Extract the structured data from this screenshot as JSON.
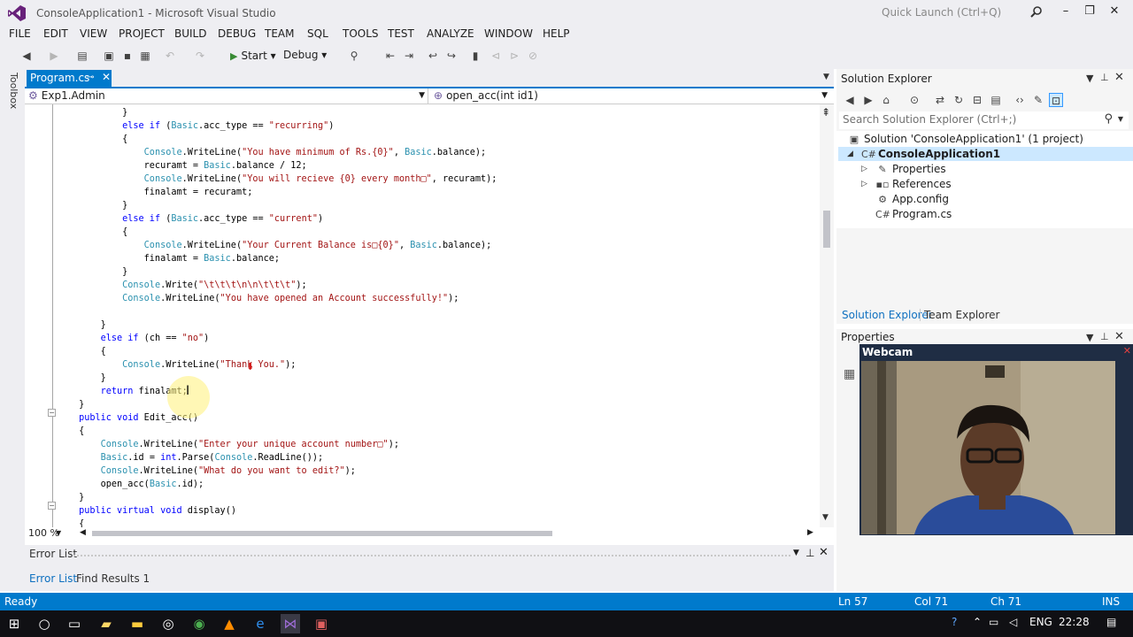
{
  "window": {
    "title": "ConsoleApplication1 - Microsoft Visual Studio",
    "quick_launch": "Quick Launch (Ctrl+Q)"
  },
  "menu": [
    "FILE",
    "EDIT",
    "VIEW",
    "PROJECT",
    "BUILD",
    "DEBUG",
    "TEAM",
    "SQL",
    "TOOLS",
    "TEST",
    "ANALYZE",
    "WINDOW",
    "HELP"
  ],
  "toolbar": {
    "start_label": "Start",
    "config": "Debug"
  },
  "toolbox_label": "Toolbox",
  "editor": {
    "tab_label": "Program.cs",
    "nav_left": "Exp1.Admin",
    "nav_right": "open_acc(int id1)",
    "zoom": "100 %",
    "code_lines": [
      [
        [
          "p",
          "                }"
        ]
      ],
      [
        [
          "p",
          "                "
        ],
        [
          "k",
          "else if"
        ],
        [
          "p",
          " ("
        ],
        [
          "c",
          "Basic"
        ],
        [
          "p",
          ".acc_type == "
        ],
        [
          "s",
          "\"recurring\""
        ],
        [
          "p",
          ")"
        ]
      ],
      [
        [
          "p",
          "                {"
        ]
      ],
      [
        [
          "p",
          "                    "
        ],
        [
          "c",
          "Console"
        ],
        [
          "p",
          ".WriteLine("
        ],
        [
          "s",
          "\"You have minimum of Rs.{0}\""
        ],
        [
          "p",
          ", "
        ],
        [
          "c",
          "Basic"
        ],
        [
          "p",
          ".balance);"
        ]
      ],
      [
        [
          "p",
          "                    recuramt = "
        ],
        [
          "c",
          "Basic"
        ],
        [
          "p",
          ".balance / 12;"
        ]
      ],
      [
        [
          "p",
          "                    "
        ],
        [
          "c",
          "Console"
        ],
        [
          "p",
          ".WriteLine("
        ],
        [
          "s",
          "\"You will recieve {0} every month□\""
        ],
        [
          "p",
          ", recuramt);"
        ]
      ],
      [
        [
          "p",
          "                    finalamt = recuramt;"
        ]
      ],
      [
        [
          "p",
          "                }"
        ]
      ],
      [
        [
          "p",
          "                "
        ],
        [
          "k",
          "else if"
        ],
        [
          "p",
          " ("
        ],
        [
          "c",
          "Basic"
        ],
        [
          "p",
          ".acc_type == "
        ],
        [
          "s",
          "\"current\""
        ],
        [
          "p",
          ")"
        ]
      ],
      [
        [
          "p",
          "                {"
        ]
      ],
      [
        [
          "p",
          "                    "
        ],
        [
          "c",
          "Console"
        ],
        [
          "p",
          ".WriteLine("
        ],
        [
          "s",
          "\"Your Current Balance is□{0}\""
        ],
        [
          "p",
          ", "
        ],
        [
          "c",
          "Basic"
        ],
        [
          "p",
          ".balance);"
        ]
      ],
      [
        [
          "p",
          "                    finalamt = "
        ],
        [
          "c",
          "Basic"
        ],
        [
          "p",
          ".balance;"
        ]
      ],
      [
        [
          "p",
          "                }"
        ]
      ],
      [
        [
          "p",
          "                "
        ],
        [
          "c",
          "Console"
        ],
        [
          "p",
          ".Write("
        ],
        [
          "s",
          "\"\\t\\t\\t\\n\\n\\t\\t\\t\""
        ],
        [
          "p",
          ");"
        ]
      ],
      [
        [
          "p",
          "                "
        ],
        [
          "c",
          "Console"
        ],
        [
          "p",
          ".WriteLine("
        ],
        [
          "s",
          "\"You have opened an Account successfully!\""
        ],
        [
          "p",
          ");"
        ]
      ],
      [
        [
          "p",
          ""
        ]
      ],
      [
        [
          "p",
          "            }"
        ]
      ],
      [
        [
          "p",
          "            "
        ],
        [
          "k",
          "else if"
        ],
        [
          "p",
          " (ch == "
        ],
        [
          "s",
          "\"no\""
        ],
        [
          "p",
          ")"
        ]
      ],
      [
        [
          "p",
          "            {"
        ]
      ],
      [
        [
          "p",
          "                "
        ],
        [
          "c",
          "Console"
        ],
        [
          "p",
          ".WriteLine("
        ],
        [
          "s",
          "\"Thank You.\""
        ],
        [
          "p",
          ");"
        ]
      ],
      [
        [
          "p",
          "            }"
        ]
      ],
      [
        [
          "p",
          "            "
        ],
        [
          "k",
          "return"
        ],
        [
          "p",
          " finalamt;"
        ]
      ],
      [
        [
          "p",
          "        }"
        ]
      ],
      [
        [
          "p",
          "        "
        ],
        [
          "k",
          "public void"
        ],
        [
          "p",
          " Edit_acc()"
        ]
      ],
      [
        [
          "p",
          "        {"
        ]
      ],
      [
        [
          "p",
          "            "
        ],
        [
          "c",
          "Console"
        ],
        [
          "p",
          ".WriteLine("
        ],
        [
          "s",
          "\"Enter your unique account number□\""
        ],
        [
          "p",
          ");"
        ]
      ],
      [
        [
          "p",
          "            "
        ],
        [
          "c",
          "Basic"
        ],
        [
          "p",
          ".id = "
        ],
        [
          "k",
          "int"
        ],
        [
          "p",
          ".Parse("
        ],
        [
          "c",
          "Console"
        ],
        [
          "p",
          ".ReadLine());"
        ]
      ],
      [
        [
          "p",
          "            "
        ],
        [
          "c",
          "Console"
        ],
        [
          "p",
          ".WriteLine("
        ],
        [
          "s",
          "\"What do you want to edit?\""
        ],
        [
          "p",
          ");"
        ]
      ],
      [
        [
          "p",
          "            open_acc("
        ],
        [
          "c",
          "Basic"
        ],
        [
          "p",
          ".id);"
        ]
      ],
      [
        [
          "p",
          "        }"
        ]
      ],
      [
        [
          "p",
          "        "
        ],
        [
          "k",
          "public virtual void"
        ],
        [
          "p",
          " display()"
        ]
      ],
      [
        [
          "p",
          "        {"
        ]
      ]
    ]
  },
  "error_list": {
    "title": "Error List",
    "tab_errors": "Error List",
    "tab_find": "Find Results 1"
  },
  "solution_explorer": {
    "title": "Solution Explorer",
    "search_placeholder": "Search Solution Explorer (Ctrl+;)",
    "solution": "Solution 'ConsoleApplication1' (1 project)",
    "project": "ConsoleApplication1",
    "items": [
      "Properties",
      "References",
      "App.config",
      "Program.cs"
    ],
    "tab_solution": "Solution Explorer",
    "tab_team": "Team Explorer"
  },
  "properties": {
    "title": "Properties"
  },
  "webcam": {
    "title": "Webcam"
  },
  "statusbar": {
    "ready": "Ready",
    "ln": "Ln 57",
    "col": "Col 71",
    "ch": "Ch 71",
    "ins": "INS"
  },
  "taskbar": {
    "language": "ENG",
    "time": "22:28"
  },
  "colors": {
    "accent": "#007acc",
    "keyword": "#0000ff",
    "type": "#2b91af",
    "string": "#a31515"
  }
}
